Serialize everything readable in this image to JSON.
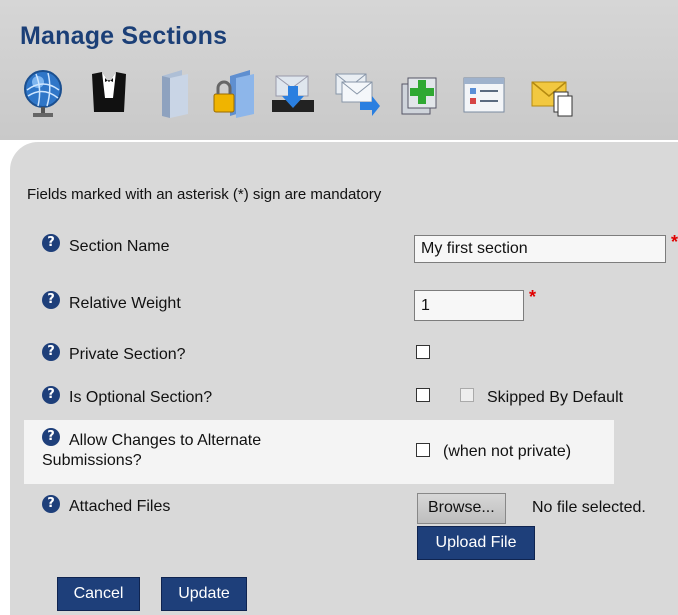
{
  "page": {
    "title": "Manage Sections"
  },
  "toolbar": {
    "icons": [
      "globe-icon",
      "tuxedo-icon",
      "folder-icon",
      "locked-folder-icon",
      "download-tray-icon",
      "forward-mail-icon",
      "add-copy-icon",
      "form-list-icon",
      "mail-copy-icon"
    ]
  },
  "form": {
    "mandatory_note": "Fields marked with an asterisk (*) sign are mandatory",
    "asterisk": "*",
    "section_name": {
      "label": "Section Name",
      "value": "My first section"
    },
    "relative_weight": {
      "label": "Relative Weight",
      "value": "1"
    },
    "private_section": {
      "label": "Private Section?",
      "checked": false
    },
    "optional_section": {
      "label": "Is Optional Section?",
      "checked": false,
      "skipped_label": "Skipped By Default",
      "skipped_checked": false
    },
    "allow_changes": {
      "label_line1": "Allow Changes to Alternate",
      "label_line2": "Submissions?",
      "note": "(when not private)",
      "checked": false
    },
    "attached_files": {
      "label": "Attached Files",
      "browse": "Browse...",
      "status": "No file selected.",
      "upload": "Upload File"
    }
  },
  "actions": {
    "cancel": "Cancel",
    "update": "Update"
  },
  "colors": {
    "title": "#1b3f77",
    "button": "#1e3f7a",
    "required": "#e00000"
  }
}
